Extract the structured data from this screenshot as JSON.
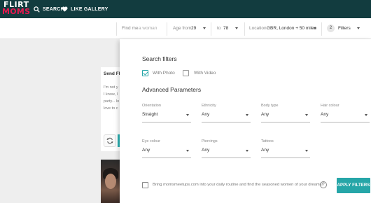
{
  "brand": {
    "logo_line1": "FLIRT",
    "logo_line2": "MOMS"
  },
  "nav": {
    "search": {
      "label": "SEARCH",
      "icon": "search-icon"
    },
    "like_gallery": {
      "label": "LIKE GALLERY",
      "icon": "heart-icon"
    }
  },
  "filterbar": {
    "find_me": {
      "label": "Find me",
      "placeholder": "a woman"
    },
    "age_from": {
      "label": "Age from",
      "value": "29"
    },
    "age_to": {
      "label": "to",
      "value": "78"
    },
    "location": {
      "label": "Location",
      "value": "GBR, London + 50 miles"
    },
    "filters": {
      "count": "2",
      "label": "Filters"
    }
  },
  "background": {
    "card_title": "Send Flirt",
    "card_text_lines": [
      "I'm not y",
      "I know, I",
      "party... lo",
      "love to c"
    ]
  },
  "panel": {
    "title": "Search filters",
    "with_photo": {
      "label": "With Photo",
      "checked": true
    },
    "with_video": {
      "label": "With Video",
      "checked": false
    },
    "advanced_title": "Advanced Parameters",
    "fields": {
      "orientation": {
        "label": "Orientation",
        "value": "Straight"
      },
      "ethnicity": {
        "label": "Ethnicity",
        "value": "Any"
      },
      "body_type": {
        "label": "Body type",
        "value": "Any"
      },
      "hair_colour": {
        "label": "Hair colour",
        "value": "Any"
      },
      "eye_colour": {
        "label": "Eye colour",
        "value": "Any"
      },
      "piercings": {
        "label": "Piercings",
        "value": "Any"
      },
      "tattoos": {
        "label": "Tattoos",
        "value": "Any"
      }
    },
    "routine_text": "Bring momsmeetups.com into your daily routine and find the seasoned women of your dreams!",
    "help_symbol": "?",
    "apply_label": "APPLY FILTERS"
  },
  "colors": {
    "nav_bg": "#123c3f",
    "accent": "#26a6a8",
    "logo_pink": "#e8184f"
  }
}
